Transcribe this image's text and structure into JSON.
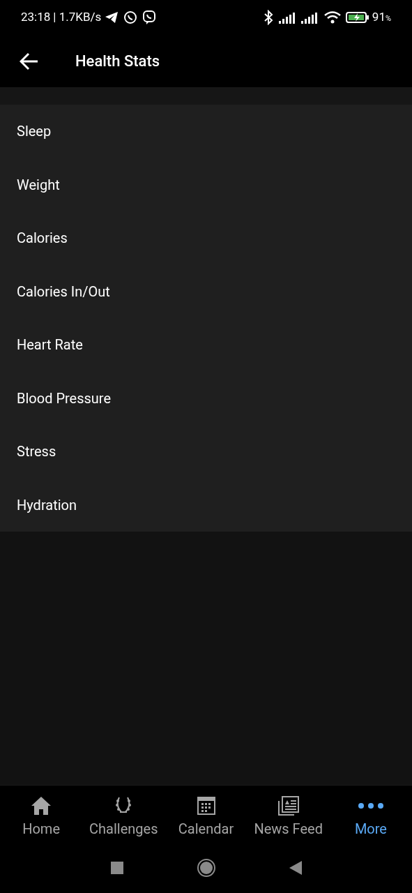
{
  "status_bar": {
    "time": "23:18",
    "speed": "| 1.7KB/s",
    "battery_percent": "91",
    "battery_unit": "%"
  },
  "app_bar": {
    "title": "Health Stats"
  },
  "items": [
    "Sleep",
    "Weight",
    "Calories",
    "Calories In/Out",
    "Heart Rate",
    "Blood Pressure",
    "Stress",
    "Hydration"
  ],
  "bottom_nav": [
    {
      "label": "Home",
      "kind": "home",
      "selected": false
    },
    {
      "label": "Challenges",
      "kind": "laurel",
      "selected": false
    },
    {
      "label": "Calendar",
      "kind": "calendar",
      "selected": false
    },
    {
      "label": "News Feed",
      "kind": "news",
      "selected": false
    },
    {
      "label": "More",
      "kind": "more",
      "selected": true
    }
  ]
}
